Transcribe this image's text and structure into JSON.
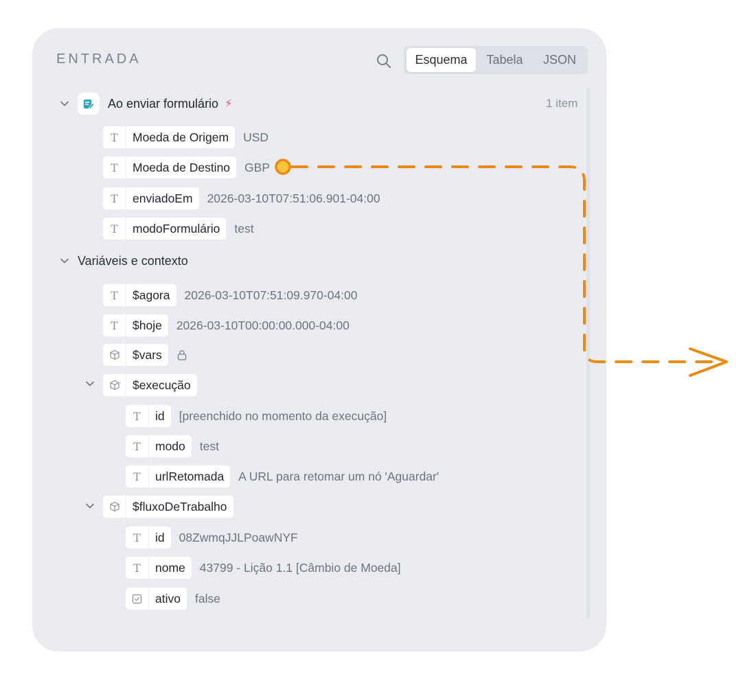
{
  "panel": {
    "title": "ENTRADA",
    "tabs": [
      {
        "label": "Esquema",
        "active": true
      },
      {
        "label": "Tabela",
        "active": false
      },
      {
        "label": "JSON",
        "active": false
      }
    ]
  },
  "trigger": {
    "label": "Ao enviar formulário",
    "count": "1 item",
    "icon": "form-edit-icon",
    "fields": [
      {
        "name": "Moeda de Origem",
        "value": "USD"
      },
      {
        "name": "Moeda de Destino",
        "value": "GBP"
      },
      {
        "name": "enviadoEm",
        "value": "2026-03-10T07:51:06.901-04:00"
      },
      {
        "name": "modoFormulário",
        "value": "test"
      }
    ]
  },
  "context": {
    "label": "Variáveis e contexto",
    "agora": {
      "name": "$agora",
      "value": "2026-03-10T07:51:09.970-04:00"
    },
    "hoje": {
      "name": "$hoje",
      "value": "2026-03-10T00:00:00.000-04:00"
    },
    "vars": {
      "name": "$vars"
    },
    "execucao": {
      "name": "$execução",
      "fields": [
        {
          "name": "id",
          "value": "[preenchido no momento da execução]"
        },
        {
          "name": "modo",
          "value": "test"
        },
        {
          "name": "urlRetomada",
          "value": "A URL para retomar um nó 'Aguardar'"
        }
      ]
    },
    "fluxo": {
      "name": "$fluxoDeTrabalho",
      "fields": [
        {
          "name": "id",
          "value": "08ZwmqJJLPoawNYF"
        },
        {
          "name": "nome",
          "value": "43799 - Lição 1.1 [Câmbio de Moeda]"
        },
        {
          "name": "ativo",
          "value": "false"
        }
      ]
    }
  },
  "colors": {
    "panel_bg": "#e9ebf1",
    "connector": "#ea8a12",
    "handle": "#f7c23c",
    "trigger_bolt": "#ef5a5a"
  }
}
